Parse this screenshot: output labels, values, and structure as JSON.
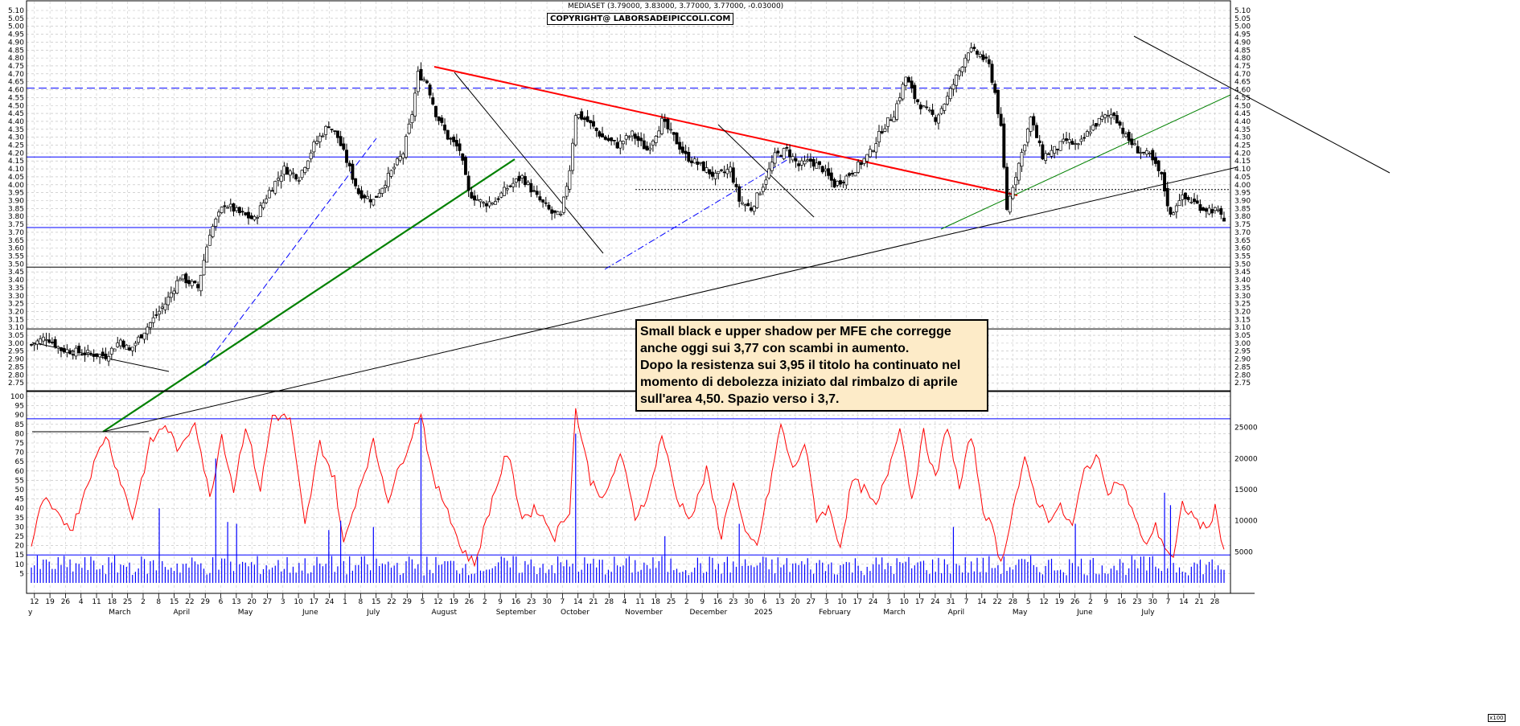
{
  "header": {
    "title": "MEDIASET (3.79000, 3.83000, 3.77000, 3.77000, -0.03000)",
    "copyright": "COPYRIGHT@ LABORSADEIPICCOLI.COM"
  },
  "note": {
    "lines": [
      "Small black e upper shadow per MFE che corregge",
      "anche oggi sui 3,77 con scambi in aumento.",
      "Dopo la resistenza sui 3,95 il titolo ha continuato nel",
      "momento di debolezza iniziato dal rimbalzo di aprile",
      "sull'area 4,50. Spazio verso i 3,7."
    ]
  },
  "volume_scale_label": "x100",
  "colors": {
    "resistance_line": "#ff0000",
    "support_line": "#008000",
    "levels": "#0000ff",
    "oscillator": "#ff0000",
    "volume": "#0000ff"
  },
  "chart_data": [
    {
      "type": "candlestick",
      "title": "MEDIASET",
      "last": {
        "open": 3.79,
        "high": 3.83,
        "low": 3.77,
        "close": 3.77,
        "change": -0.03
      },
      "ylim": [
        2.7,
        5.1
      ],
      "y_ticks": [
        "2.75",
        "2.80",
        "2.85",
        "2.90",
        "2.95",
        "3.00",
        "3.05",
        "3.10",
        "3.15",
        "3.20",
        "3.25",
        "3.30",
        "3.35",
        "3.40",
        "3.45",
        "3.50",
        "3.55",
        "3.60",
        "3.65",
        "3.70",
        "3.75",
        "3.80",
        "3.85",
        "3.90",
        "3.95",
        "4.00",
        "4.05",
        "4.10",
        "4.15",
        "4.20",
        "4.25",
        "4.30",
        "4.35",
        "4.40",
        "4.45",
        "4.50",
        "4.55",
        "4.60",
        "4.65",
        "4.70",
        "4.75",
        "4.80",
        "4.85",
        "4.90",
        "4.95",
        "5.00",
        "5.05",
        "5.10"
      ],
      "x_day_labels": [
        "12",
        "19",
        "26",
        "4",
        "11",
        "18",
        "25",
        "2",
        "8",
        "15",
        "22",
        "29",
        "6",
        "13",
        "20",
        "27",
        "3",
        "10",
        "17",
        "24",
        "1",
        "8",
        "15",
        "22",
        "29",
        "5",
        "12",
        "19",
        "26",
        "2",
        "9",
        "16",
        "23",
        "30",
        "7",
        "14",
        "21",
        "28",
        "4",
        "11",
        "18",
        "25",
        "2",
        "9",
        "16",
        "23",
        "30",
        "6",
        "13",
        "20",
        "27",
        "3",
        "10",
        "17",
        "24",
        "3",
        "10",
        "17",
        "24",
        "31",
        "7",
        "14",
        "22",
        "28",
        "5",
        "12",
        "19",
        "26",
        "2",
        "9",
        "16",
        "23",
        "30",
        "7",
        "14",
        "21",
        "28"
      ],
      "x_month_labels": [
        "y",
        "March",
        "April",
        "May",
        "June",
        "July",
        "August",
        "September",
        "October",
        "November",
        "December",
        "2025",
        "February",
        "March",
        "April",
        "May",
        "June",
        "July"
      ],
      "horizontal_levels": [
        {
          "value": 4.61,
          "style": "dashed",
          "color": "#0000ff"
        },
        {
          "value": 4.175,
          "style": "solid",
          "color": "#0000ff"
        },
        {
          "value": 3.97,
          "style": "dotted",
          "color": "#000000"
        },
        {
          "value": 3.73,
          "style": "solid",
          "color": "#0000ff"
        },
        {
          "value": 3.48,
          "style": "solid",
          "color": "#000000"
        },
        {
          "value": 3.09,
          "style": "solid",
          "color": "#000000"
        }
      ],
      "anchor_points": [
        {
          "i": 0,
          "v": 2.99
        },
        {
          "i": 5,
          "v": 3.04
        },
        {
          "i": 10,
          "v": 2.96
        },
        {
          "i": 17,
          "v": 2.94
        },
        {
          "i": 25,
          "v": 2.92
        },
        {
          "i": 30,
          "v": 3.02
        },
        {
          "i": 33,
          "v": 2.95
        },
        {
          "i": 38,
          "v": 3.08
        },
        {
          "i": 45,
          "v": 3.25
        },
        {
          "i": 50,
          "v": 3.42
        },
        {
          "i": 56,
          "v": 3.35
        },
        {
          "i": 60,
          "v": 3.7
        },
        {
          "i": 65,
          "v": 3.88
        },
        {
          "i": 70,
          "v": 3.82
        },
        {
          "i": 75,
          "v": 3.78
        },
        {
          "i": 80,
          "v": 3.96
        },
        {
          "i": 85,
          "v": 4.1
        },
        {
          "i": 90,
          "v": 4.05
        },
        {
          "i": 95,
          "v": 4.25
        },
        {
          "i": 100,
          "v": 4.38
        },
        {
          "i": 103,
          "v": 4.3
        },
        {
          "i": 106,
          "v": 4.15
        },
        {
          "i": 110,
          "v": 3.95
        },
        {
          "i": 115,
          "v": 3.9
        },
        {
          "i": 120,
          "v": 4.05
        },
        {
          "i": 125,
          "v": 4.2
        },
        {
          "i": 128,
          "v": 4.45
        },
        {
          "i": 130,
          "v": 4.7
        },
        {
          "i": 133,
          "v": 4.65
        },
        {
          "i": 136,
          "v": 4.45
        },
        {
          "i": 140,
          "v": 4.3
        },
        {
          "i": 144,
          "v": 4.22
        },
        {
          "i": 147,
          "v": 3.95
        },
        {
          "i": 152,
          "v": 3.88
        },
        {
          "i": 156,
          "v": 3.9
        },
        {
          "i": 160,
          "v": 3.98
        },
        {
          "i": 165,
          "v": 4.05
        },
        {
          "i": 170,
          "v": 3.92
        },
        {
          "i": 175,
          "v": 3.82
        },
        {
          "i": 178,
          "v": 3.8
        },
        {
          "i": 181,
          "v": 4.1
        },
        {
          "i": 183,
          "v": 4.45
        },
        {
          "i": 187,
          "v": 4.4
        },
        {
          "i": 192,
          "v": 4.3
        },
        {
          "i": 197,
          "v": 4.25
        },
        {
          "i": 202,
          "v": 4.32
        },
        {
          "i": 207,
          "v": 4.22
        },
        {
          "i": 212,
          "v": 4.4
        },
        {
          "i": 216,
          "v": 4.3
        },
        {
          "i": 220,
          "v": 4.18
        },
        {
          "i": 225,
          "v": 4.12
        },
        {
          "i": 230,
          "v": 4.05
        },
        {
          "i": 235,
          "v": 4.1
        },
        {
          "i": 238,
          "v": 3.9
        },
        {
          "i": 242,
          "v": 3.85
        },
        {
          "i": 246,
          "v": 4.0
        },
        {
          "i": 250,
          "v": 4.18
        },
        {
          "i": 254,
          "v": 4.22
        },
        {
          "i": 258,
          "v": 4.12
        },
        {
          "i": 262,
          "v": 4.15
        },
        {
          "i": 266,
          "v": 4.1
        },
        {
          "i": 270,
          "v": 4.0
        },
        {
          "i": 274,
          "v": 4.05
        },
        {
          "i": 278,
          "v": 4.12
        },
        {
          "i": 282,
          "v": 4.2
        },
        {
          "i": 286,
          "v": 4.35
        },
        {
          "i": 290,
          "v": 4.45
        },
        {
          "i": 294,
          "v": 4.68
        },
        {
          "i": 297,
          "v": 4.55
        },
        {
          "i": 300,
          "v": 4.48
        },
        {
          "i": 304,
          "v": 4.42
        },
        {
          "i": 308,
          "v": 4.55
        },
        {
          "i": 312,
          "v": 4.72
        },
        {
          "i": 315,
          "v": 4.85
        },
        {
          "i": 319,
          "v": 4.82
        },
        {
          "i": 322,
          "v": 4.75
        },
        {
          "i": 324,
          "v": 4.58
        },
        {
          "i": 326,
          "v": 4.35
        },
        {
          "i": 328,
          "v": 3.85
        },
        {
          "i": 330,
          "v": 4.0
        },
        {
          "i": 333,
          "v": 4.2
        },
        {
          "i": 336,
          "v": 4.42
        },
        {
          "i": 340,
          "v": 4.18
        },
        {
          "i": 344,
          "v": 4.22
        },
        {
          "i": 348,
          "v": 4.28
        },
        {
          "i": 352,
          "v": 4.24
        },
        {
          "i": 356,
          "v": 4.35
        },
        {
          "i": 360,
          "v": 4.42
        },
        {
          "i": 364,
          "v": 4.45
        },
        {
          "i": 368,
          "v": 4.3
        },
        {
          "i": 372,
          "v": 4.22
        },
        {
          "i": 376,
          "v": 4.18
        },
        {
          "i": 380,
          "v": 4.05
        },
        {
          "i": 383,
          "v": 3.8
        },
        {
          "i": 386,
          "v": 3.92
        },
        {
          "i": 390,
          "v": 3.9
        },
        {
          "i": 394,
          "v": 3.85
        },
        {
          "i": 398,
          "v": 3.84
        },
        {
          "i": 400,
          "v": 3.8
        },
        {
          "i": 401,
          "v": 3.77
        }
      ],
      "oscillator": {
        "ylim": [
          0,
          100
        ],
        "y_ticks": [
          "5",
          "10",
          "15",
          "20",
          "25",
          "30",
          "35",
          "40",
          "45",
          "50",
          "55",
          "60",
          "65",
          "70",
          "75",
          "80",
          "85",
          "90",
          "95",
          "100"
        ],
        "levels": [
          88,
          15
        ],
        "anchor_points": [
          {
            "i": 0,
            "v": 20
          },
          {
            "i": 4,
            "v": 45
          },
          {
            "i": 9,
            "v": 35
          },
          {
            "i": 14,
            "v": 30
          },
          {
            "i": 19,
            "v": 55
          },
          {
            "i": 25,
            "v": 80
          },
          {
            "i": 30,
            "v": 55
          },
          {
            "i": 34,
            "v": 35
          },
          {
            "i": 40,
            "v": 75
          },
          {
            "i": 45,
            "v": 85
          },
          {
            "i": 50,
            "v": 70
          },
          {
            "i": 55,
            "v": 88
          },
          {
            "i": 60,
            "v": 45
          },
          {
            "i": 64,
            "v": 80
          },
          {
            "i": 68,
            "v": 50
          },
          {
            "i": 72,
            "v": 85
          },
          {
            "i": 77,
            "v": 50
          },
          {
            "i": 81,
            "v": 90
          },
          {
            "i": 87,
            "v": 88
          },
          {
            "i": 92,
            "v": 30
          },
          {
            "i": 97,
            "v": 75
          },
          {
            "i": 102,
            "v": 55
          },
          {
            "i": 105,
            "v": 20
          },
          {
            "i": 110,
            "v": 50
          },
          {
            "i": 115,
            "v": 75
          },
          {
            "i": 120,
            "v": 45
          },
          {
            "i": 128,
            "v": 80
          },
          {
            "i": 131,
            "v": 92
          },
          {
            "i": 135,
            "v": 55
          },
          {
            "i": 140,
            "v": 40
          },
          {
            "i": 144,
            "v": 20
          },
          {
            "i": 149,
            "v": 10
          },
          {
            "i": 155,
            "v": 45
          },
          {
            "i": 160,
            "v": 70
          },
          {
            "i": 165,
            "v": 35
          },
          {
            "i": 170,
            "v": 40
          },
          {
            "i": 176,
            "v": 25
          },
          {
            "i": 181,
            "v": 40
          },
          {
            "i": 183,
            "v": 93
          },
          {
            "i": 188,
            "v": 55
          },
          {
            "i": 193,
            "v": 45
          },
          {
            "i": 198,
            "v": 70
          },
          {
            "i": 203,
            "v": 35
          },
          {
            "i": 208,
            "v": 50
          },
          {
            "i": 212,
            "v": 80
          },
          {
            "i": 217,
            "v": 45
          },
          {
            "i": 222,
            "v": 35
          },
          {
            "i": 227,
            "v": 60
          },
          {
            "i": 232,
            "v": 25
          },
          {
            "i": 236,
            "v": 55
          },
          {
            "i": 240,
            "v": 25
          },
          {
            "i": 244,
            "v": 20
          },
          {
            "i": 248,
            "v": 50
          },
          {
            "i": 252,
            "v": 85
          },
          {
            "i": 256,
            "v": 60
          },
          {
            "i": 260,
            "v": 75
          },
          {
            "i": 264,
            "v": 35
          },
          {
            "i": 268,
            "v": 40
          },
          {
            "i": 272,
            "v": 20
          },
          {
            "i": 276,
            "v": 55
          },
          {
            "i": 280,
            "v": 50
          },
          {
            "i": 284,
            "v": 40
          },
          {
            "i": 288,
            "v": 60
          },
          {
            "i": 292,
            "v": 85
          },
          {
            "i": 296,
            "v": 45
          },
          {
            "i": 300,
            "v": 80
          },
          {
            "i": 304,
            "v": 55
          },
          {
            "i": 308,
            "v": 85
          },
          {
            "i": 312,
            "v": 50
          },
          {
            "i": 316,
            "v": 80
          },
          {
            "i": 320,
            "v": 40
          },
          {
            "i": 324,
            "v": 25
          },
          {
            "i": 326,
            "v": 10
          },
          {
            "i": 330,
            "v": 40
          },
          {
            "i": 334,
            "v": 65
          },
          {
            "i": 338,
            "v": 45
          },
          {
            "i": 342,
            "v": 35
          },
          {
            "i": 346,
            "v": 40
          },
          {
            "i": 350,
            "v": 30
          },
          {
            "i": 354,
            "v": 60
          },
          {
            "i": 358,
            "v": 68
          },
          {
            "i": 362,
            "v": 50
          },
          {
            "i": 366,
            "v": 55
          },
          {
            "i": 370,
            "v": 40
          },
          {
            "i": 374,
            "v": 20
          },
          {
            "i": 378,
            "v": 30
          },
          {
            "i": 381,
            "v": 20
          },
          {
            "i": 384,
            "v": 12
          },
          {
            "i": 387,
            "v": 42
          },
          {
            "i": 391,
            "v": 35
          },
          {
            "i": 395,
            "v": 28
          },
          {
            "i": 398,
            "v": 40
          },
          {
            "i": 401,
            "v": 18
          }
        ]
      },
      "volume": {
        "ylim": [
          0,
          30000
        ],
        "y_ticks": [
          "5000",
          "10000",
          "15000",
          "20000",
          "25000"
        ],
        "spikes": [
          {
            "i": 43,
            "v": 12000
          },
          {
            "i": 62,
            "v": 20000
          },
          {
            "i": 66,
            "v": 9800
          },
          {
            "i": 69,
            "v": 9500
          },
          {
            "i": 100,
            "v": 8500
          },
          {
            "i": 104,
            "v": 10000
          },
          {
            "i": 115,
            "v": 9000
          },
          {
            "i": 131,
            "v": 26500
          },
          {
            "i": 183,
            "v": 24000
          },
          {
            "i": 213,
            "v": 7500
          },
          {
            "i": 238,
            "v": 9500
          },
          {
            "i": 310,
            "v": 9000
          },
          {
            "i": 351,
            "v": 9500
          },
          {
            "i": 381,
            "v": 14500
          },
          {
            "i": 383,
            "v": 12500
          }
        ]
      }
    }
  ]
}
